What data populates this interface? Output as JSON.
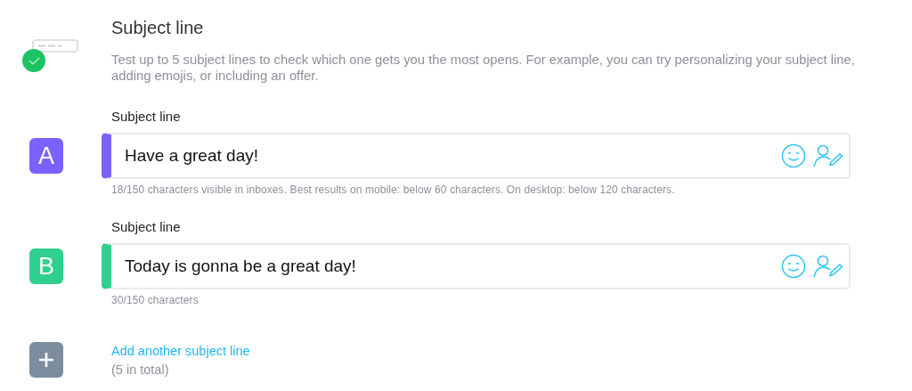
{
  "header": {
    "title": "Subject line",
    "description": "Test up to 5 subject lines to check which one gets you the most opens. For example, you can try personalizing your subject line, adding emojis, or including an offer."
  },
  "variants": [
    {
      "letter": "A",
      "color": "#7b61ff",
      "label": "Subject line",
      "value": "Have a great day!",
      "hint": "18/150 characters visible in inboxes. Best results on mobile: below 60 characters. On desktop: below 120 characters."
    },
    {
      "letter": "B",
      "color": "#2fd08e",
      "label": "Subject line",
      "value": "Today is gonna be a great day!",
      "hint": "30/150 characters"
    }
  ],
  "add": {
    "link": "Add another subject line",
    "note": "(5 in total)"
  }
}
